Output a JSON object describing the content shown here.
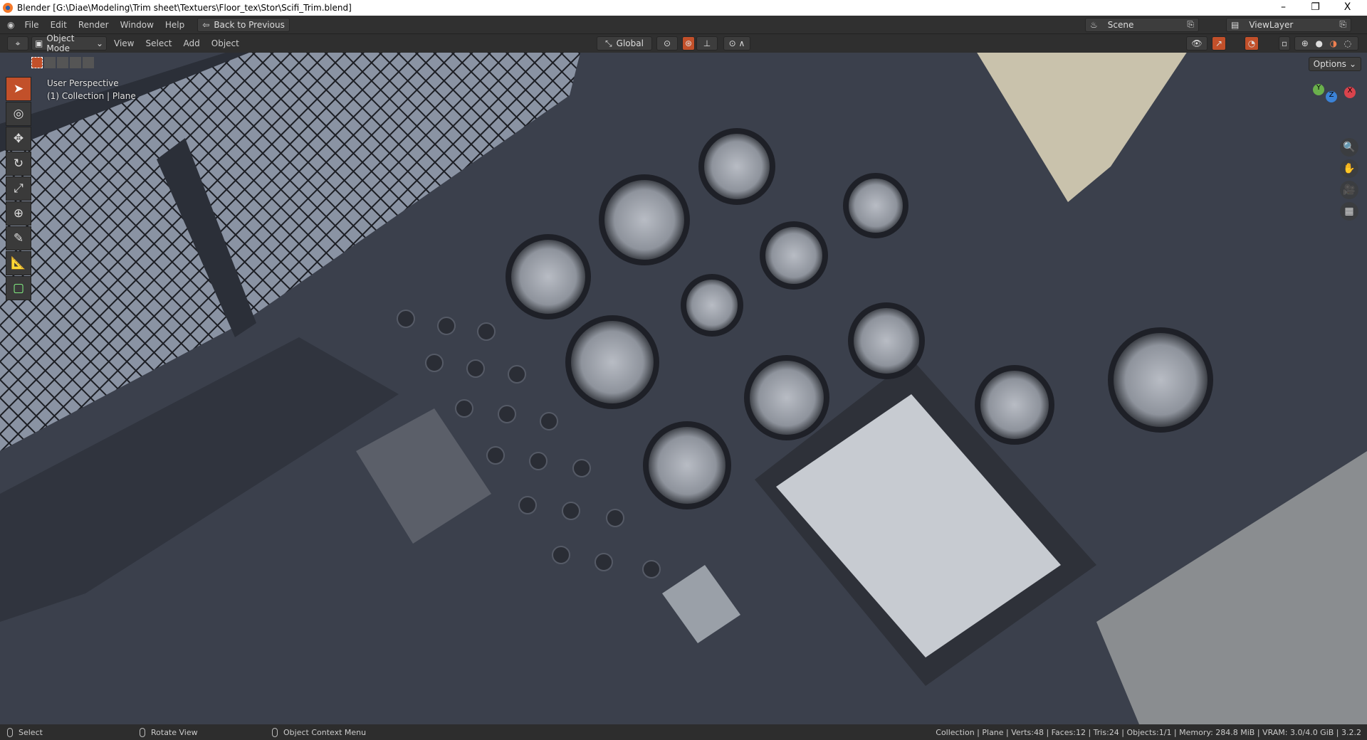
{
  "window": {
    "title": "Blender [G:\\Diae\\Modeling\\Trim sheet\\Textuers\\Floor_tex\\Stor\\Scifi_Trim.blend]",
    "minimize": "–",
    "restore": "❐",
    "close": "X"
  },
  "topbar": {
    "menus": [
      "File",
      "Edit",
      "Render",
      "Window",
      "Help"
    ],
    "back_button": "Back to Previous",
    "scene": "Scene",
    "view_layer": "ViewLayer"
  },
  "header": {
    "mode": "Object Mode",
    "menus": [
      "View",
      "Select",
      "Add",
      "Object"
    ],
    "orientation": "Global",
    "options": "Options"
  },
  "viewport": {
    "perspective": "User Perspective",
    "collection": "(1) Collection | Plane",
    "gizmo_axes": [
      "Y",
      "Z",
      "X"
    ]
  },
  "statusbar": {
    "hints": [
      "Select",
      "Rotate View",
      "Object Context Menu"
    ],
    "stats": "Collection | Plane | Verts:48 | Faces:12 | Tris:24 | Objects:1/1 | Memory: 284.8 MiB | VRAM: 3.0/4.0 GiB | 3.2.2"
  }
}
